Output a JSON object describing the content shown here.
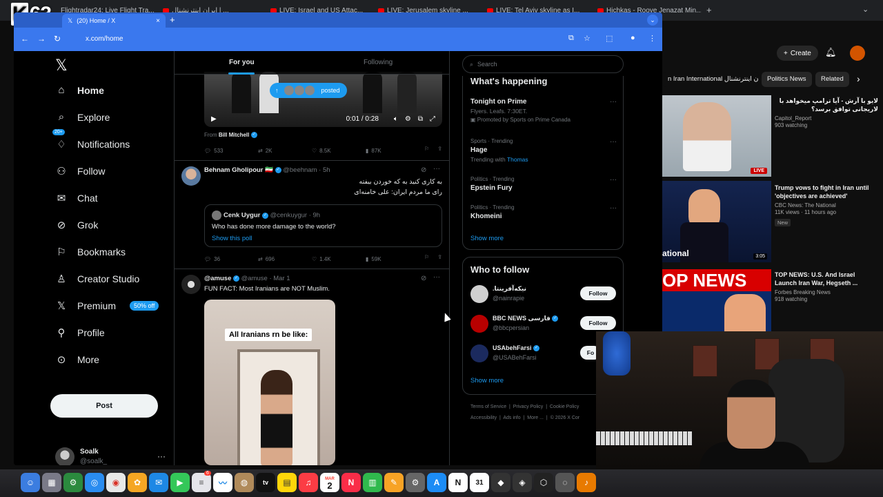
{
  "overlay": {
    "channel_logo": "63",
    "channel_logo_k": "K"
  },
  "outer_tabs": [
    {
      "label": "Flightradar24: Live Flight Tra..."
    },
    {
      "label": "ایران اینترنشنال | ..."
    },
    {
      "label": "ایران اینترنشنال | ..."
    },
    {
      "label": "LIVE: Israel and US Attac..."
    },
    {
      "label": "LIVE: Jerusalem skyline ..."
    },
    {
      "label": "LIVE: Tel Aviv skyline as I..."
    },
    {
      "label": "Hichkas - Rooye Jenazat Min..."
    }
  ],
  "browser": {
    "tab_title": "(20) Home / X",
    "url": "x.com/home"
  },
  "nav": {
    "items": [
      {
        "label": "Home",
        "icon": "home-icon"
      },
      {
        "label": "Explore",
        "icon": "search-icon"
      },
      {
        "label": "Notifications",
        "icon": "bell-icon"
      },
      {
        "label": "Follow",
        "icon": "person-plus-icon"
      },
      {
        "label": "Chat",
        "icon": "mail-icon"
      },
      {
        "label": "Grok",
        "icon": "grok-icon"
      },
      {
        "label": "Bookmarks",
        "icon": "bookmark-icon"
      },
      {
        "label": "Creator Studio",
        "icon": "creator-icon"
      },
      {
        "label": "Premium",
        "icon": "x-icon"
      },
      {
        "label": "Profile",
        "icon": "person-icon"
      },
      {
        "label": "More",
        "icon": "more-circle-icon"
      }
    ],
    "notif_badge": "20+",
    "premium_badge": "50% off",
    "post_label": "Post",
    "account_name": "Soalk",
    "account_handle": "@soalk_"
  },
  "timeline": {
    "tabs": [
      "For you",
      "Following"
    ],
    "post1": {
      "posted_label": "posted",
      "video_time": "0:01 / 0:28",
      "from_prefix": "From",
      "from_name": "Bill Mitchell",
      "stats": {
        "replies": "533",
        "reposts": "2K",
        "likes": "8.5K",
        "views": "87K"
      }
    },
    "post2": {
      "name": "Behnam Gholipour 🇮🇷",
      "handle": "@beehnam · 5h",
      "text_line1": "به کاری کنید به که خوردن بیفته",
      "text_line2": "رای ما مردم ایران: علی خامنه‌ای",
      "quote": {
        "name": "Cenk Uygur",
        "handle": "@cenkuygur · 9h",
        "text": "Who has done more damage to the world?",
        "link": "Show this poll"
      },
      "stats": {
        "replies": "36",
        "reposts": "696",
        "likes": "1.4K",
        "views": "59K"
      }
    },
    "post3": {
      "name": "@amuse",
      "handle": "@amuse · Mar 1",
      "text": "FUN FACT: Most Iranians are NOT Muslim.",
      "meme_caption": "All Iranians rn be like:"
    }
  },
  "right": {
    "search_placeholder": "Search",
    "trends_title": "What's happening",
    "trends": [
      {
        "meta": "",
        "name": "Tonight on Prime",
        "sub": "Flyers. Leafs. 7:30ET.",
        "sub2": "Promoted by Sports on Prime Canada"
      },
      {
        "meta": "Sports · Trending",
        "name": "Hage",
        "sub": "Trending with",
        "link": "Thomas"
      },
      {
        "meta": "Politics · Trending",
        "name": "Epstein Fury"
      },
      {
        "meta": "Politics · Trending",
        "name": "Khomeini"
      }
    ],
    "show_more": "Show more",
    "who_title": "Who to follow",
    "who": [
      {
        "name": ".نیکه‌آفرینتا",
        "handle": "@nainrapie",
        "btn": "Follow",
        "color": "#cfcfcf"
      },
      {
        "name": "BBC NEWS فارسی",
        "handle": "@bbcpersian",
        "btn": "Follow",
        "color": "#b80000"
      },
      {
        "name": "USAbehFarsi",
        "handle": "@USABehFarsi",
        "btn": "Fo",
        "color": "#1b2a5e"
      }
    ],
    "who_show_more": "Show more",
    "footer": [
      "Terms of Service",
      "Privacy Policy",
      "Cookie Policy",
      "Accessibility",
      "Ads info",
      "More ...",
      "© 2026 X Cor"
    ]
  },
  "youtube": {
    "create": "Create",
    "chips": [
      "n Iran International ایران اینترنشنال",
      "Politics News",
      "Related"
    ],
    "videos": [
      {
        "title": "لایو با آرش - آیا ترامپ میخواهد با لاریجانی توافق برسد؟",
        "channel": "Capitol_Report",
        "meta": "903 watching",
        "badge": "LIVE"
      },
      {
        "title": "Trump vows to fight in Iran until 'objectives are achieved'",
        "channel": "CBC News: The National",
        "meta": "11K views · 11 hours ago",
        "badge": "3:05",
        "tag": "New",
        "thumb_text": "ational"
      },
      {
        "title": "TOP NEWS: U.S. And Israel Launch Iran War, Hegseth ...",
        "channel": "Forbes Breaking News",
        "meta": "918 watching",
        "thumb_text": "OP NEWS"
      }
    ]
  },
  "dock": {
    "calendar_day": "2",
    "calendar_month": "MAR",
    "badge": "6"
  }
}
